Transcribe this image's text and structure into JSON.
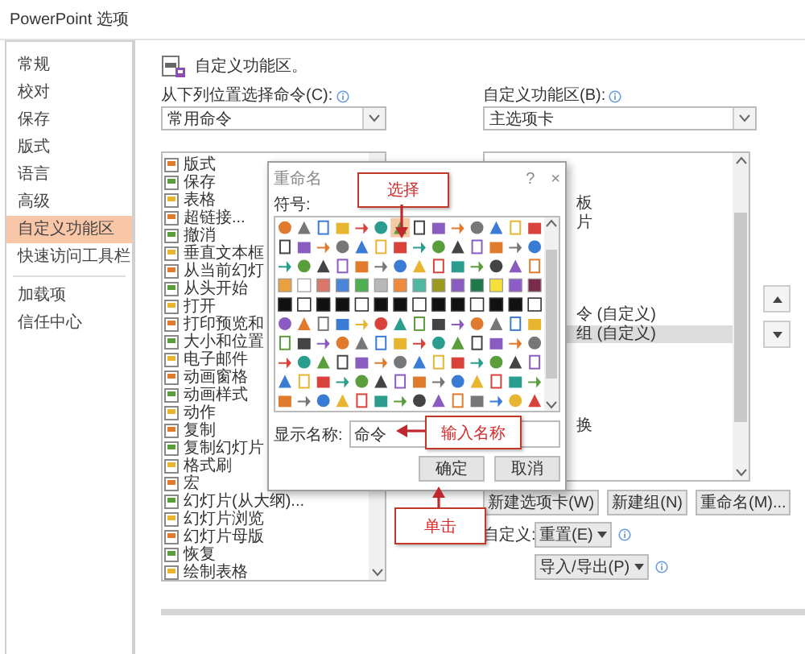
{
  "window": {
    "title": "PowerPoint 选项"
  },
  "sidebar": {
    "sections": [
      {
        "items": [
          {
            "label": "常规",
            "selected": false
          },
          {
            "label": "校对",
            "selected": false
          },
          {
            "label": "保存",
            "selected": false
          },
          {
            "label": "版式",
            "selected": false
          },
          {
            "label": "语言",
            "selected": false
          },
          {
            "label": "高级",
            "selected": false
          },
          {
            "label": "自定义功能区",
            "selected": true
          },
          {
            "label": "快速访问工具栏",
            "selected": false
          }
        ]
      },
      {
        "items": [
          {
            "label": "加载项",
            "selected": false
          },
          {
            "label": "信任中心",
            "selected": false
          }
        ]
      }
    ]
  },
  "header": {
    "text": "自定义功能区。"
  },
  "commands": {
    "label": "从下列位置选择命令(C):",
    "dropdown": "常用命令",
    "items": [
      "版式",
      "保存",
      "表格",
      "超链接...",
      "撤消",
      "垂直文本框",
      "从当前幻灯",
      "从头开始",
      "打开",
      "打印预览和",
      "大小和位置",
      "电子邮件",
      "动画窗格",
      "动画样式",
      "动作",
      "复制",
      "复制幻灯片",
      "格式刷",
      "宏",
      "幻灯片(从大纲)...",
      "幻灯片浏览",
      "幻灯片母版",
      "恢复",
      "绘制表格"
    ]
  },
  "ribbon": {
    "label": "自定义功能区(B):",
    "dropdown": "主选项卡",
    "items": [
      {
        "text": "板",
        "selected": false
      },
      {
        "text": "片",
        "selected": false
      },
      {
        "text": "令 (自定义)",
        "selected": false
      },
      {
        "text": "组 (自定义)",
        "selected": true
      },
      {
        "text": "换",
        "selected": false
      }
    ]
  },
  "ribbon_buttons": [
    "新建选项卡(W)",
    "新建组(N)",
    "重命名(M)..."
  ],
  "customize": {
    "label": "自定义:",
    "reset": "重置(E)",
    "import_export": "导入/导出(P)"
  },
  "dialog": {
    "title": "重命名",
    "help": "?",
    "close": "×",
    "symbols_label": "符号:",
    "symbols": [
      {
        "selected": false
      },
      {
        "selected": false
      },
      {
        "selected": false
      },
      {
        "selected": false
      },
      {
        "selected": false
      },
      {
        "selected": false
      },
      {
        "selected": true
      },
      {
        "selected": false
      },
      {
        "selected": false
      },
      {
        "selected": false
      },
      {
        "selected": false
      },
      {
        "selected": false
      },
      {
        "selected": false
      },
      {
        "selected": false
      },
      {
        "selected": false
      },
      {
        "selected": false
      },
      {
        "selected": false
      },
      {
        "selected": false
      },
      {
        "selected": false
      },
      {
        "selected": false
      },
      {
        "selected": false
      },
      {
        "selected": false
      },
      {
        "selected": false
      },
      {
        "selected": false
      },
      {
        "selected": false
      },
      {
        "selected": false
      },
      {
        "selected": false
      },
      {
        "selected": false
      },
      {
        "selected": false
      },
      {
        "selected": false
      },
      {
        "selected": false
      },
      {
        "selected": false
      },
      {
        "selected": false
      },
      {
        "selected": false
      },
      {
        "selected": false
      },
      {
        "selected": false
      },
      {
        "selected": false
      },
      {
        "selected": false
      },
      {
        "selected": false
      },
      {
        "selected": false
      },
      {
        "selected": false
      },
      {
        "selected": false
      },
      {
        "selected": false
      },
      {
        "selected": false
      },
      {
        "selected": false
      },
      {
        "selected": false
      },
      {
        "selected": false
      },
      {
        "selected": false
      },
      {
        "selected": false
      },
      {
        "selected": false
      },
      {
        "selected": false
      },
      {
        "selected": false
      },
      {
        "selected": false
      },
      {
        "selected": false
      },
      {
        "selected": false
      },
      {
        "selected": false
      },
      {
        "selected": false
      },
      {
        "selected": false
      },
      {
        "selected": false
      },
      {
        "selected": false
      },
      {
        "selected": false
      },
      {
        "selected": false
      },
      {
        "selected": false
      },
      {
        "selected": false
      },
      {
        "selected": false
      },
      {
        "selected": false
      },
      {
        "selected": false
      },
      {
        "selected": false
      },
      {
        "selected": false
      },
      {
        "selected": false
      },
      {
        "selected": false
      },
      {
        "selected": false
      },
      {
        "selected": false
      },
      {
        "selected": false
      },
      {
        "selected": false
      },
      {
        "selected": false
      },
      {
        "selected": false
      },
      {
        "selected": false
      },
      {
        "selected": false
      },
      {
        "selected": false
      },
      {
        "selected": false
      },
      {
        "selected": false
      },
      {
        "selected": false
      },
      {
        "selected": false
      },
      {
        "selected": false
      },
      {
        "selected": false
      },
      {
        "selected": false
      },
      {
        "selected": false
      },
      {
        "selected": false
      },
      {
        "selected": false
      },
      {
        "selected": false
      },
      {
        "selected": false
      },
      {
        "selected": false
      },
      {
        "selected": false
      },
      {
        "selected": false
      },
      {
        "selected": false
      },
      {
        "selected": false
      },
      {
        "selected": false
      },
      {
        "selected": false
      },
      {
        "selected": false
      },
      {
        "selected": false
      },
      {
        "selected": false
      },
      {
        "selected": false
      },
      {
        "selected": false
      },
      {
        "selected": false
      },
      {
        "selected": false
      },
      {
        "selected": false
      },
      {
        "selected": false
      },
      {
        "selected": false
      },
      {
        "selected": false
      },
      {
        "selected": false
      },
      {
        "selected": false
      },
      {
        "selected": false
      },
      {
        "selected": false
      },
      {
        "selected": false
      },
      {
        "selected": false
      },
      {
        "selected": false
      },
      {
        "selected": false
      },
      {
        "selected": false
      },
      {
        "selected": false
      },
      {
        "selected": false
      },
      {
        "selected": false
      },
      {
        "selected": false
      },
      {
        "selected": false
      },
      {
        "selected": false
      },
      {
        "selected": false
      },
      {
        "selected": false
      },
      {
        "selected": false
      },
      {
        "selected": false
      },
      {
        "selected": false
      },
      {
        "selected": false
      },
      {
        "selected": false
      },
      {
        "selected": false
      },
      {
        "selected": false
      },
      {
        "selected": false
      },
      {
        "selected": false
      },
      {
        "selected": false
      },
      {
        "selected": false
      },
      {
        "selected": false
      },
      {
        "selected": false
      }
    ],
    "name_label": "显示名称:",
    "name_value": "命令",
    "buttons": [
      "确定",
      "取消"
    ]
  },
  "callouts": [
    {
      "text": "选择"
    },
    {
      "text": "输入名称"
    },
    {
      "text": "单击"
    }
  ]
}
